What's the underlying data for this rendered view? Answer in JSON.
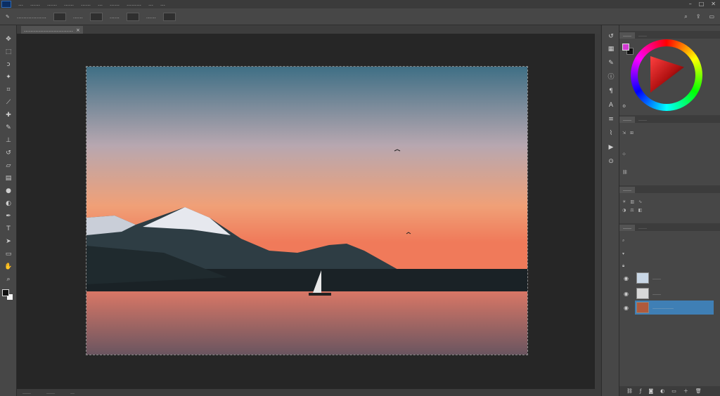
{
  "menubar": {
    "app_icon": "photoshop-logo",
    "items": [
      "…",
      "……",
      "……",
      "……",
      "……",
      "…",
      "……",
      "………",
      "…",
      "…"
    ],
    "window_controls": [
      "minimize",
      "maximize",
      "close"
    ]
  },
  "options_bar": {
    "tool_icon": "brush-icon",
    "preset_label": "………………",
    "size_label": "……",
    "mode_label": "……",
    "opacity_label": "……",
    "right_icons": [
      "search-icon",
      "share-icon",
      "workspace-icon"
    ]
  },
  "document_tab": {
    "title": "…………………………",
    "close_icon": "close-icon"
  },
  "toolbar": {
    "tools": [
      "move-icon",
      "marquee-icon",
      "lasso-icon",
      "quick-select-icon",
      "crop-icon",
      "eyedropper-icon",
      "healing-icon",
      "brush-icon",
      "stamp-icon",
      "history-brush-icon",
      "eraser-icon",
      "gradient-icon",
      "blur-icon",
      "dodge-icon",
      "pen-icon",
      "type-icon",
      "path-select-icon",
      "shape-icon",
      "hand-icon",
      "zoom-icon"
    ],
    "foreground_color": "#111111",
    "background_color": "#f5f5f5"
  },
  "canvas": {
    "image_description": "sunset over mountains with a sailboat on a lake",
    "sky_top_color": "#3f6f85",
    "sky_mid_color": "#f0a077",
    "horizon_color": "#f07a5a",
    "water_color": "#c86a63"
  },
  "statusbar": {
    "items": [
      "……",
      "……",
      "…"
    ]
  },
  "panels": {
    "color_tabs": [
      "……",
      "……"
    ],
    "foreground_swatch": "#d23ad2",
    "properties_tabs": [
      "……",
      "……"
    ],
    "adjust_tabs": [
      "……"
    ],
    "layers_tabs": [
      "……",
      "……"
    ],
    "layers": [
      {
        "name": "……",
        "thumb_color": "#c9d7e6"
      },
      {
        "name": "……",
        "thumb_color": "#d8d8d8"
      },
      {
        "name": "……………",
        "thumb_color": "#b05a3c"
      }
    ],
    "selected_layer_index": 2
  }
}
